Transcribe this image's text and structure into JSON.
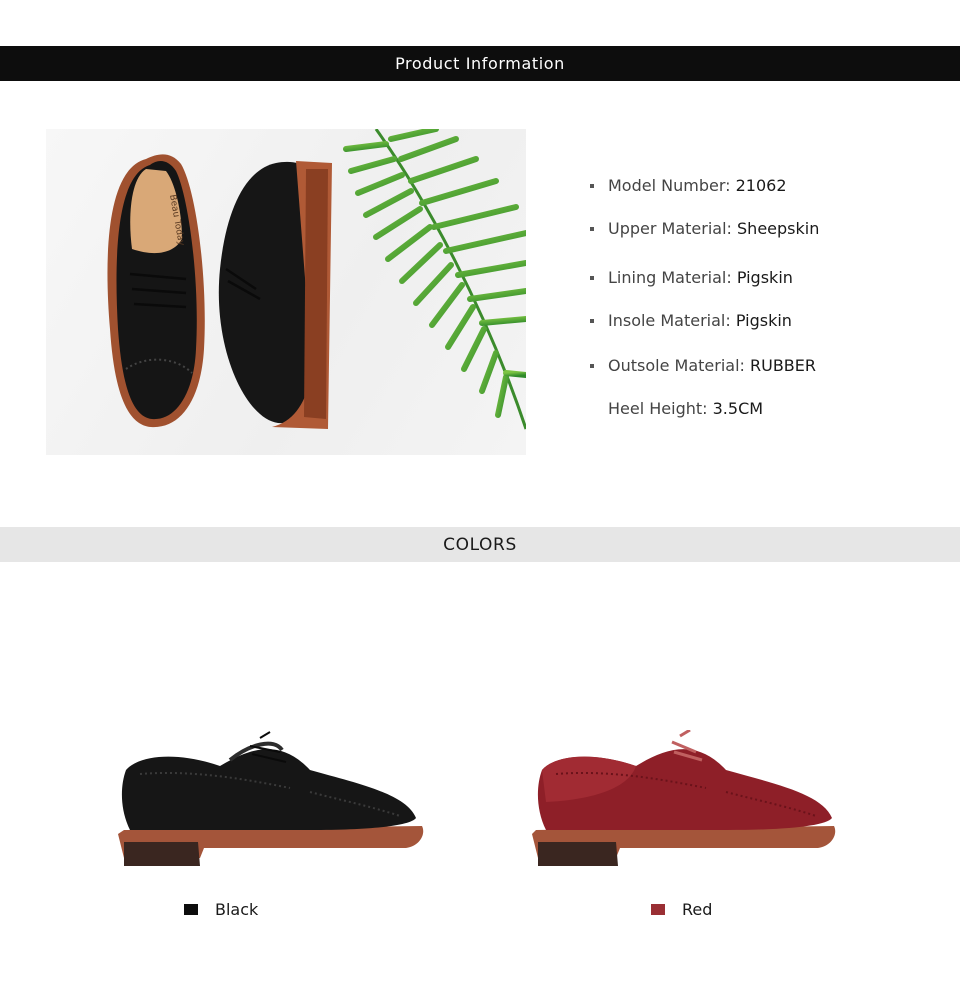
{
  "header": {
    "title": "Product Information"
  },
  "hero": {
    "insole_brand": "Beau Today"
  },
  "specs": [
    {
      "label": "Model Number:",
      "value": "21062",
      "bullet": true
    },
    {
      "label": "Upper Material:",
      "value": "Sheepskin",
      "bullet": true
    },
    {
      "label": "Lining Material:",
      "value": "Pigskin",
      "bullet": true
    },
    {
      "label": "Insole Material:",
      "value": "Pigskin",
      "bullet": true
    },
    {
      "label": "Outsole Material:",
      "value": "RUBBER",
      "bullet": true
    },
    {
      "label": "Heel Height:",
      "value": "3.5CM",
      "bullet": false
    }
  ],
  "colors_section": {
    "title": "COLORS"
  },
  "colors": [
    {
      "name": "Black",
      "swatch": "#0d0d0d"
    },
    {
      "name": "Red",
      "swatch": "#9a2f34"
    }
  ]
}
